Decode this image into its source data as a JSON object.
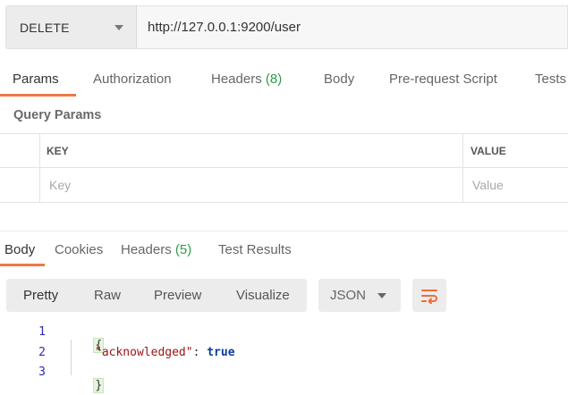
{
  "request": {
    "method": "DELETE",
    "url": "http://127.0.0.1:9200/user"
  },
  "request_tabs": [
    {
      "label": "Params",
      "count": "",
      "active": true
    },
    {
      "label": "Authorization",
      "count": "",
      "active": false
    },
    {
      "label": "Headers",
      "count": "(8)",
      "active": false
    },
    {
      "label": "Body",
      "count": "",
      "active": false
    },
    {
      "label": "Pre-request Script",
      "count": "",
      "active": false
    },
    {
      "label": "Tests",
      "count": "",
      "active": false
    }
  ],
  "query_params": {
    "title": "Query Params",
    "columns": {
      "key": "KEY",
      "value": "VALUE"
    },
    "placeholders": {
      "key": "Key",
      "value": "Value"
    }
  },
  "response_tabs": [
    {
      "label": "Body",
      "count": "",
      "active": true
    },
    {
      "label": "Cookies",
      "count": "",
      "active": false
    },
    {
      "label": "Headers",
      "count": "(5)",
      "active": false
    },
    {
      "label": "Test Results",
      "count": "",
      "active": false
    }
  ],
  "view_modes": [
    "Pretty",
    "Raw",
    "Preview",
    "Visualize"
  ],
  "active_view_mode": "Pretty",
  "format": "JSON",
  "code": {
    "line_numbers": [
      "1",
      "2",
      "3"
    ],
    "open_brace": "{",
    "key": "\"acknowledged\"",
    "colon": ": ",
    "value": "true",
    "close_brace": "}"
  },
  "colors": {
    "accent_underline": "#ef7847",
    "count_green": "#2e9c4b",
    "json_key": "#a11515",
    "json_boolean": "#0b3ba0",
    "wrap_icon": "#f26b3a"
  },
  "icons": {
    "method_dropdown": "chevron-down-icon",
    "format_dropdown": "chevron-down-icon",
    "wrap": "wrap-lines-icon"
  }
}
